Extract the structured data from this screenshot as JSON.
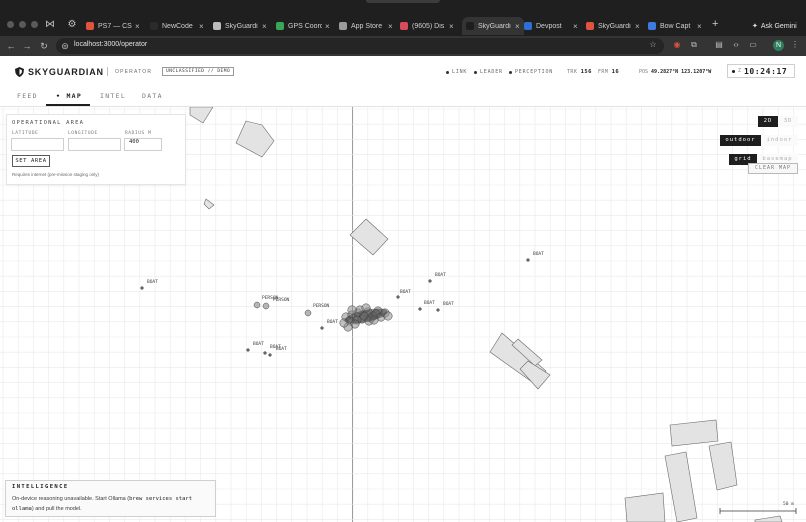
{
  "browser": {
    "tabs": [
      {
        "label": "PS7 — CS",
        "fav": "#e0533f"
      },
      {
        "label": "NewCode",
        "fav": "#2b2b2b"
      },
      {
        "label": "SkyGuardi",
        "fav": "#bdbdbd"
      },
      {
        "label": "GPS Coord",
        "fav": "#3aa757"
      },
      {
        "label": "App Store",
        "fav": "#9a9a9a"
      },
      {
        "label": "(9605) Dis",
        "fav": "#d94b5b"
      },
      {
        "label": "SkyGuardi",
        "fav": "#1e1e1e",
        "active": true
      },
      {
        "label": "Devpost",
        "fav": "#2d6fd6"
      },
      {
        "label": "SkyGuardi",
        "fav": "#e0533f"
      },
      {
        "label": "Bow Capt",
        "fav": "#3d7be0"
      }
    ],
    "url": "localhost:3000/operator",
    "gemini_label": "Ask Gemini",
    "profile_initial": "N"
  },
  "header": {
    "brand": "SKYGUARDIAN",
    "role": "OPERATOR",
    "classification": "UNCLASSIFIED // DEMO",
    "status_items": [
      "LINK",
      "LEADER",
      "PERCEPTION"
    ],
    "trk_label": "TRK",
    "trk_value": "156",
    "frm_label": "FRM",
    "frm_value": "16",
    "pos_label": "POS",
    "pos_value": "49.2827°N 123.1207°W",
    "clock_label": "Z",
    "clock_time": "10:24:17"
  },
  "nav": {
    "tabs": [
      {
        "label": "FEED",
        "active": false
      },
      {
        "label": "MAP",
        "active": true
      },
      {
        "label": "INTEL",
        "active": false
      },
      {
        "label": "DATA",
        "active": false
      }
    ]
  },
  "op_area": {
    "title": "OPERATIONAL AREA",
    "latitude_label": "LATITUDE",
    "longitude_label": "LONGITUDE",
    "radius_label": "RADIUS M",
    "latitude_value": "",
    "longitude_value": "",
    "radius_value": "400",
    "button_label": "SET AREA",
    "note": "Requires internet (pre-mission staging only)"
  },
  "map_controls": {
    "view_2d": "2D",
    "view_3d": "3D",
    "outdoor": "outdoor",
    "indoor": "indoor",
    "grid": "grid",
    "basemap": "basemap",
    "clear": "CLEAR MAP",
    "scale": "50 m"
  },
  "detections": [
    {
      "label": "BOAT"
    },
    {
      "label": "BOAT"
    },
    {
      "label": "BOAT"
    },
    {
      "label": "BOAT"
    },
    {
      "label": "BOAT"
    },
    {
      "label": "BOAT"
    },
    {
      "label": "BOAT"
    },
    {
      "label": "BOAT"
    },
    {
      "label": "BOAT"
    },
    {
      "label": "BOAT"
    },
    {
      "label": "PERSON"
    },
    {
      "label": "PERSON"
    },
    {
      "label": "PERSON"
    }
  ],
  "intel": {
    "title": "INTELLIGENCE",
    "text_before": "On-device reasoning unavailable. Start Ollama (",
    "code": "brew services start ollama",
    "text_after": ") and pull the model."
  }
}
